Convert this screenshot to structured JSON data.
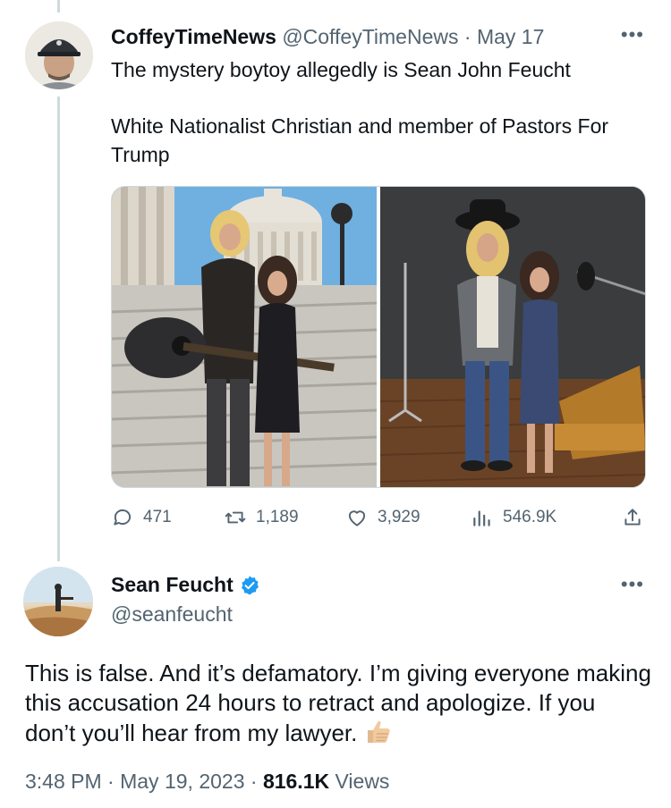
{
  "tweet1": {
    "display_name": "CoffeyTimeNews",
    "handle": "@CoffeyTimeNews",
    "separator": "·",
    "date": "May 17",
    "text_line1": "The mystery boytoy allegedly is Sean John Feucht",
    "text_line2": "White Nationalist Christian and member of Pastors For Trump",
    "actions": {
      "replies": "471",
      "retweets": "1,189",
      "likes": "3,929",
      "views": "546.9K"
    }
  },
  "tweet2": {
    "display_name": "Sean Feucht",
    "handle": "@seanfeucht",
    "text": "This is false.  And it’s defamatory. I’m giving everyone making this accusation 24 hours to retract and apologize.  If you don’t you’ll hear from my lawyer.",
    "time": "3:48 PM",
    "separator": "·",
    "date": "May 19, 2023",
    "views_count": "816.1K",
    "views_label": "Views"
  },
  "colors": {
    "primary_text": "#0f1419",
    "secondary_text": "#536471",
    "verified_blue": "#1d9bf0",
    "thread_line": "#cfd9de"
  },
  "icons": [
    "more-icon",
    "reply-icon",
    "retweet-icon",
    "like-icon",
    "views-icon",
    "share-icon",
    "verified-badge-icon",
    "thumbs-up-emoji"
  ]
}
